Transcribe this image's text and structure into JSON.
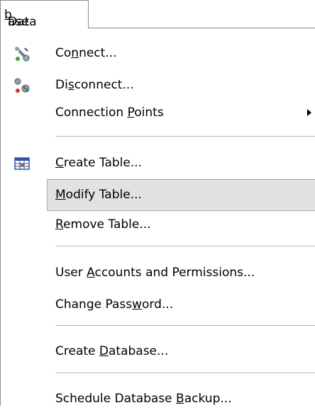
{
  "menubar": {
    "title_prefix": "Data",
    "title_mnemonic": "b",
    "title_suffix": "ase"
  },
  "menu": {
    "connect": {
      "pre": "Co",
      "key": "n",
      "post": "nect..."
    },
    "disconnect": {
      "pre": "Di",
      "key": "s",
      "post": "connect..."
    },
    "connection_points": {
      "pre": "Connection ",
      "key": "P",
      "post": "oints"
    },
    "create_table": {
      "pre": "",
      "key": "C",
      "post": "reate Table..."
    },
    "modify_table": {
      "pre": "",
      "key": "M",
      "post": "odify Table..."
    },
    "remove_table": {
      "pre": "",
      "key": "R",
      "post": "emove Table..."
    },
    "user_accounts": {
      "pre": "User ",
      "key": "A",
      "post": "ccounts and Permissions..."
    },
    "change_password": {
      "pre": "Change Pass",
      "key": "w",
      "post": "ord..."
    },
    "create_database": {
      "pre": "Create ",
      "key": "D",
      "post": "atabase..."
    },
    "schedule_backup": {
      "pre": "Schedule Database ",
      "key": "B",
      "post": "ackup..."
    }
  },
  "colors": {
    "highlight_bg": "#e3e2e0",
    "border": "#8a8a8a"
  }
}
